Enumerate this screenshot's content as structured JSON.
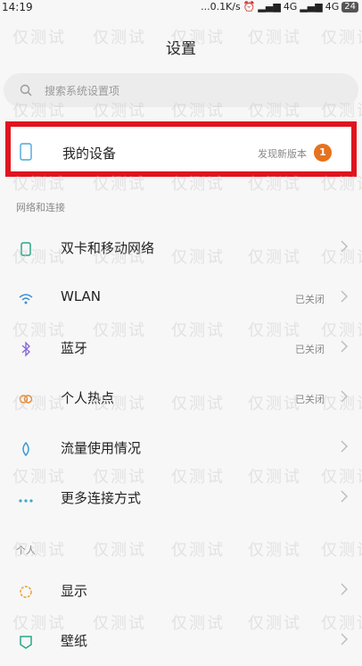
{
  "status_bar": {
    "time": "14:19",
    "network_speed": "...0.1K/s",
    "signal_1": "4G",
    "signal_2": "4G",
    "battery": "24"
  },
  "header": {
    "title": "设置"
  },
  "search": {
    "placeholder": "搜索系统设置项"
  },
  "my_device": {
    "label": "我的设备",
    "status": "发现新版本",
    "badge": "1",
    "highlight_color": "#e0141e"
  },
  "sections": {
    "network": {
      "header": "网络和连接",
      "items": [
        {
          "label": "双卡和移动网络",
          "value": "",
          "icon": "sim-card-icon"
        },
        {
          "label": "WLAN",
          "value": "已关闭",
          "icon": "wifi-icon"
        },
        {
          "label": "蓝牙",
          "value": "已关闭",
          "icon": "bluetooth-icon"
        },
        {
          "label": "个人热点",
          "value": "已关闭",
          "icon": "hotspot-icon"
        },
        {
          "label": "流量使用情况",
          "value": "",
          "icon": "data-usage-icon"
        },
        {
          "label": "更多连接方式",
          "value": "",
          "icon": "more-connections-icon"
        }
      ]
    },
    "personal": {
      "header": "个人",
      "items": [
        {
          "label": "显示",
          "value": "",
          "icon": "display-icon"
        },
        {
          "label": "壁纸",
          "value": "",
          "icon": "wallpaper-icon"
        }
      ]
    }
  },
  "watermark": "仅测试"
}
